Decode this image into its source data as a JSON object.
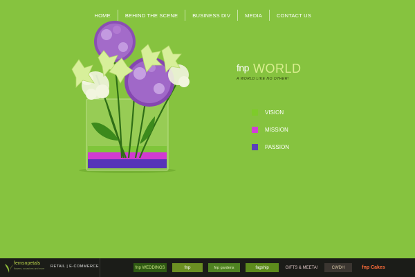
{
  "nav": {
    "items": [
      {
        "label": "HOME"
      },
      {
        "label": "BEHIND THE SCENE"
      },
      {
        "label": "BUSINESS DIV"
      },
      {
        "label": "MEDIA"
      },
      {
        "label": "CONTACT US"
      }
    ]
  },
  "brand": {
    "fnp": "fnp",
    "world": "WORLD",
    "tagline": "A WORLD LIKE NO OTHER!"
  },
  "values": [
    {
      "label": "VISION",
      "color": "#7ecb2a"
    },
    {
      "label": "MISSION",
      "color": "#d23fd6"
    },
    {
      "label": "PASSION",
      "color": "#5a3fb9"
    }
  ],
  "footer": {
    "ferns_name": "fernsnpetals",
    "ferns_sub": "flowers, occasions and more",
    "retail_label": "RETAIL | E-COMMERCE",
    "partners": [
      {
        "label": "fnp WEDDINGS",
        "bg": "#2f5a12",
        "color": "#cfe98a"
      },
      {
        "label": "fnp",
        "bg": "#6b8f22",
        "color": "#ffffff"
      },
      {
        "label": "fnp gardens",
        "bg": "#4f8222",
        "color": "#e8f5c4"
      },
      {
        "label": "fagship",
        "bg": "#5d8b1c",
        "color": "#ffffff"
      },
      {
        "label": "GIFTS & MEETA!",
        "bg": "#1b1c18",
        "color": "#e0c8c8"
      },
      {
        "label": "CWDH",
        "bg": "#3a3530",
        "color": "#d9c9a8"
      },
      {
        "label": "fnp Cakes",
        "bg": "#1b1c18",
        "color": "#ff6d3a"
      }
    ]
  }
}
